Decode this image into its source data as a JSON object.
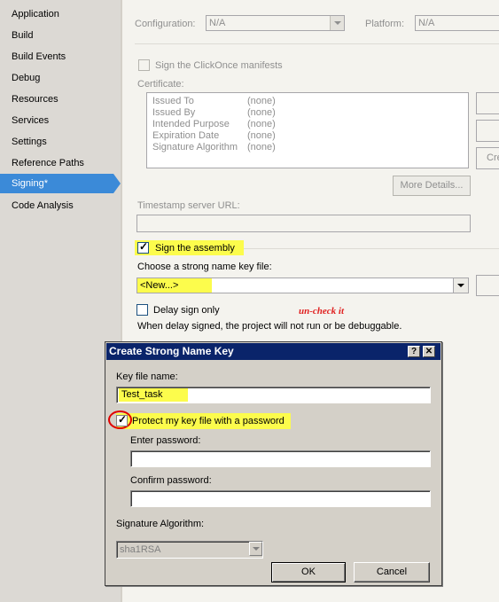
{
  "nav": {
    "items": [
      "Application",
      "Build",
      "Build Events",
      "Debug",
      "Resources",
      "Services",
      "Settings",
      "Reference Paths",
      "Signing*",
      "Code Analysis"
    ],
    "active": "Signing*"
  },
  "header": {
    "configuration_label": "Configuration:",
    "configuration_value": "N/A",
    "platform_label": "Platform:",
    "platform_value": "N/A"
  },
  "signing": {
    "clickonce_label": "Sign the ClickOnce manifests",
    "certificate_label": "Certificate:",
    "cert_rows": [
      {
        "key": "Issued To",
        "value": "(none)"
      },
      {
        "key": "Issued By",
        "value": "(none)"
      },
      {
        "key": "Intended Purpose",
        "value": "(none)"
      },
      {
        "key": "Expiration Date",
        "value": "(none)"
      },
      {
        "key": "Signature Algorithm",
        "value": "(none)"
      }
    ],
    "side_button_3": "Cre",
    "more_details": "More Details...",
    "timestamp_label": "Timestamp server URL:",
    "sign_assembly_label": "Sign the assembly",
    "strong_name_label": "Choose a strong name key file:",
    "strong_name_value": "<New...>",
    "delay_sign_label": "Delay sign only",
    "annotation": "un-check it",
    "delay_note": "When delay signed, the project will not run or be debuggable."
  },
  "dialog": {
    "title": "Create Strong Name Key",
    "help_glyph": "?",
    "close_glyph": "✕",
    "key_file_label": "Key file name:",
    "key_file_value": "Test_task",
    "protect_label": "Protect my key file with a password",
    "enter_password_label": "Enter password:",
    "confirm_password_label": "Confirm password:",
    "algorithm_label": "Signature Algorithm:",
    "algorithm_value": "sha1RSA",
    "ok": "OK",
    "cancel": "Cancel"
  },
  "colors": {
    "accent": "#3b8ad8",
    "highlight": "#fcfc4c",
    "title_bar": "#0a246a",
    "annotation": "#e02020"
  }
}
